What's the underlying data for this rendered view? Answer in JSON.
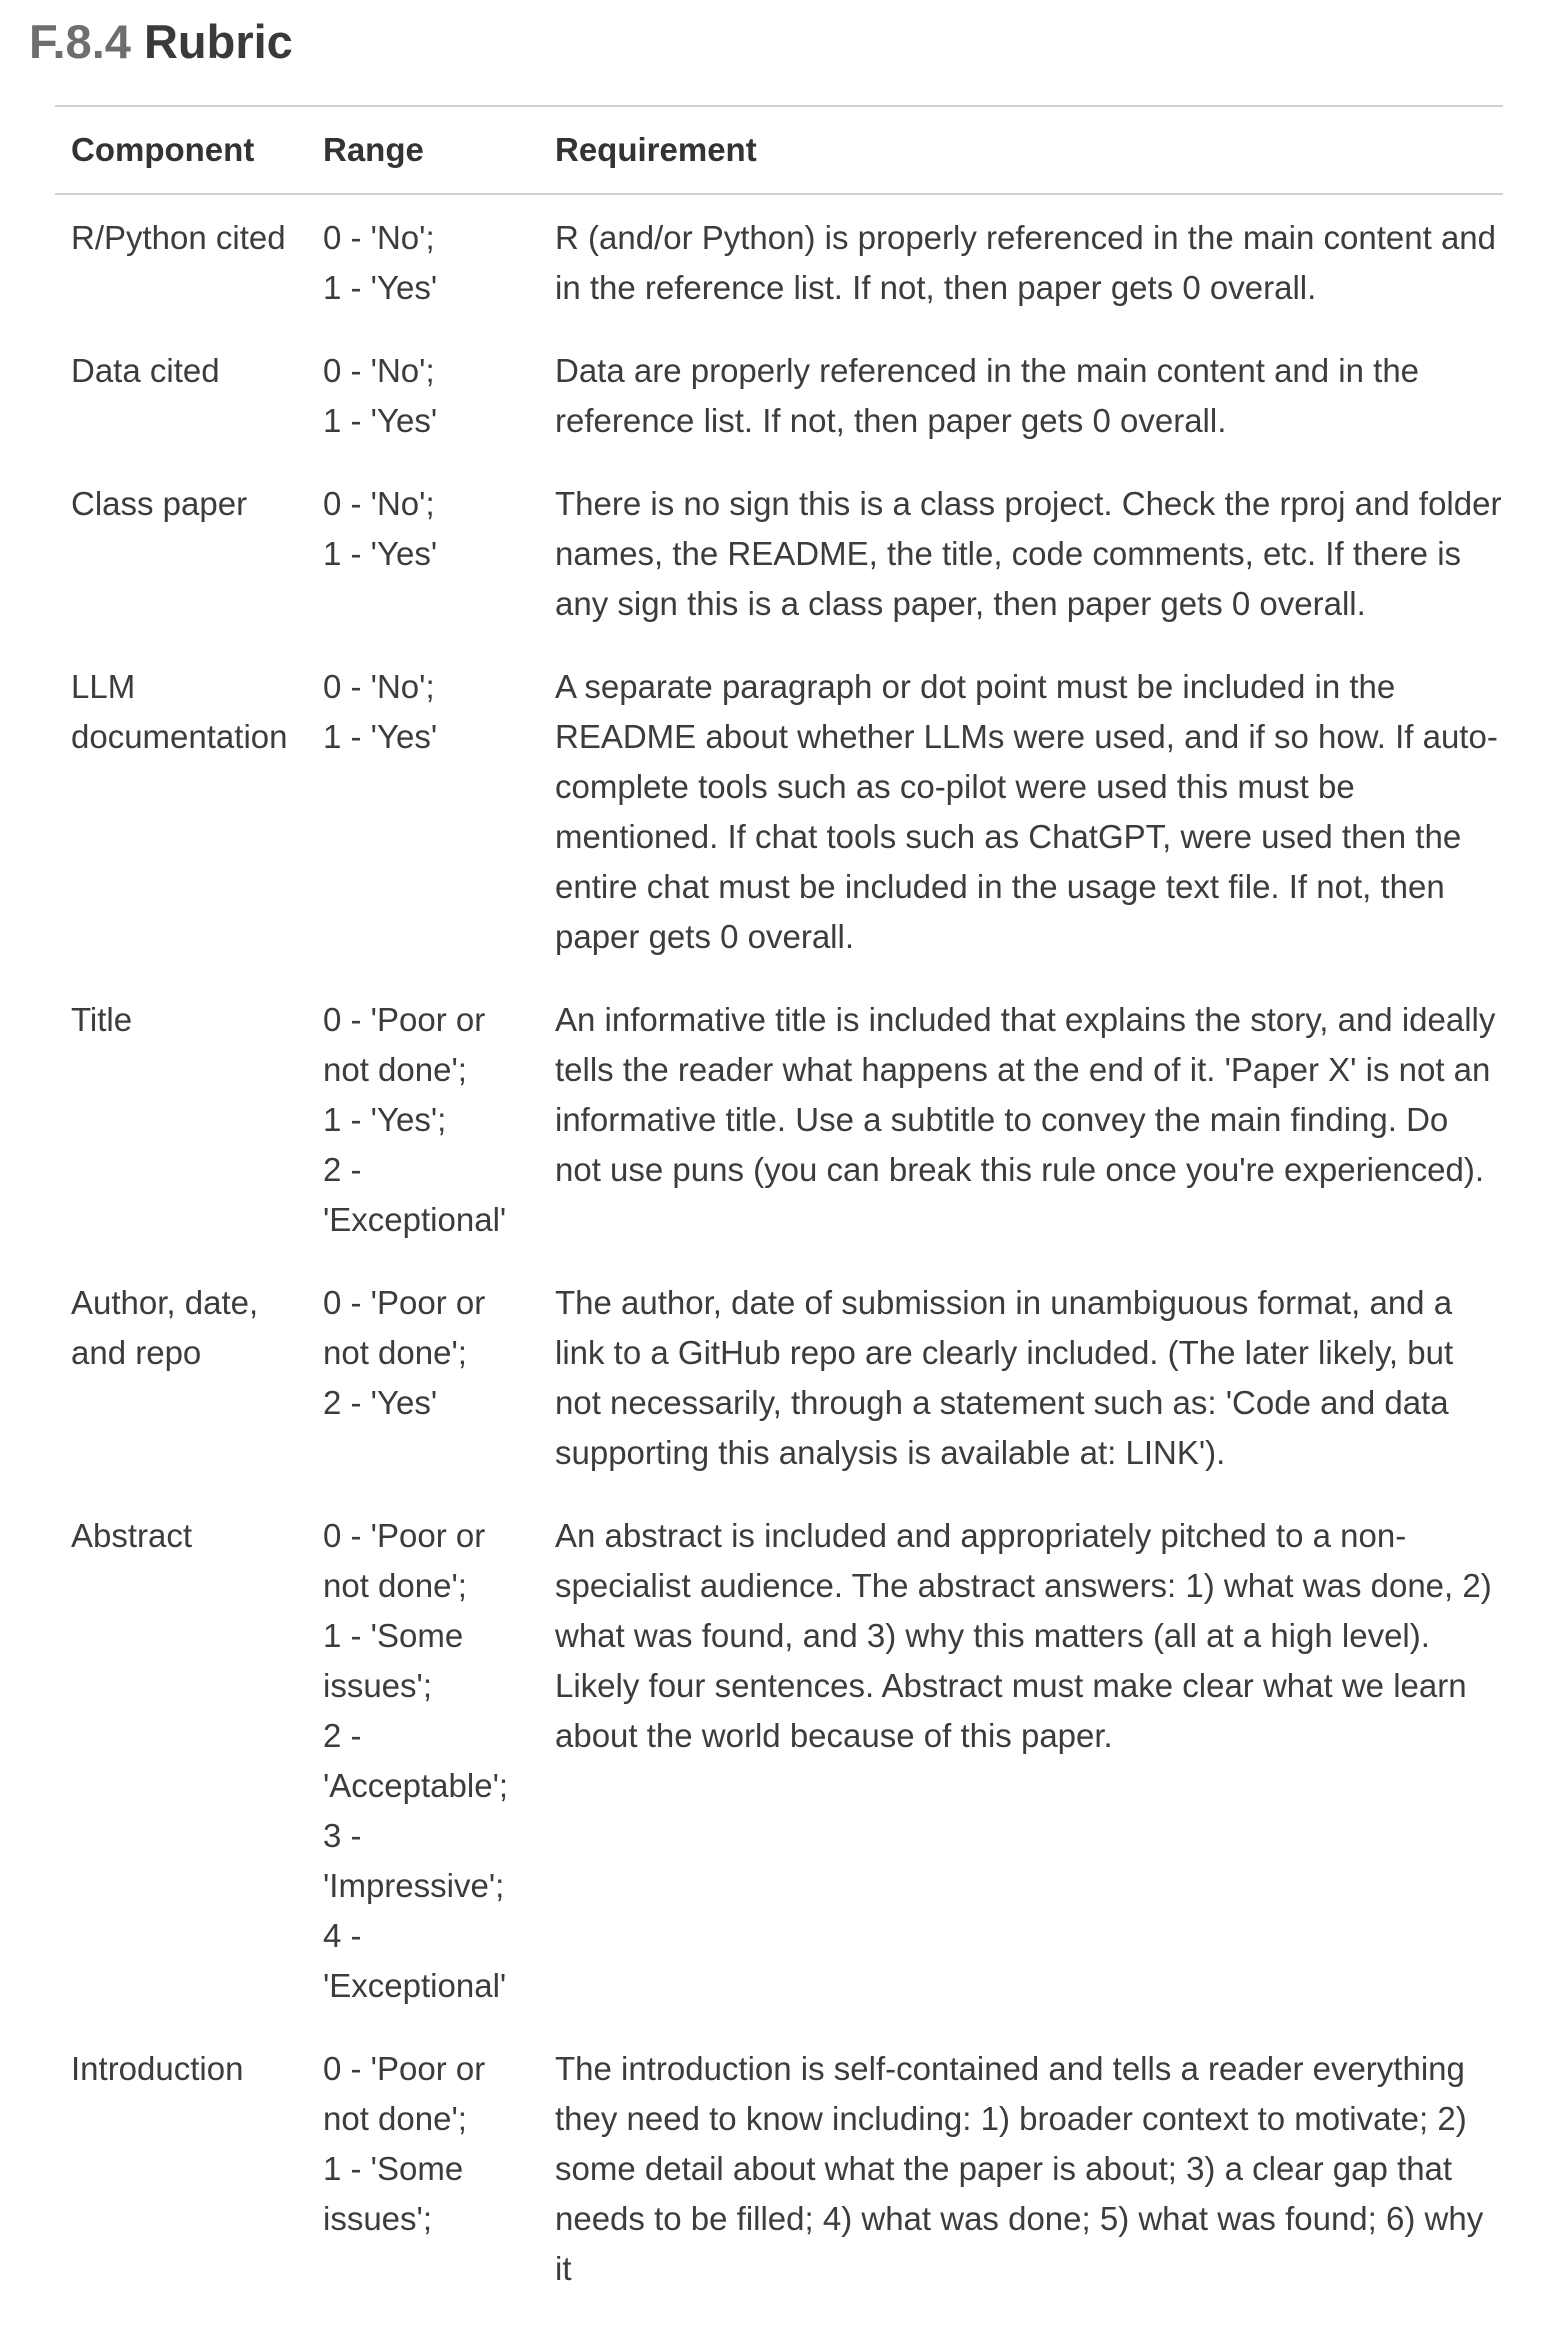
{
  "section": {
    "number": "F.8.4",
    "title": "Rubric"
  },
  "table": {
    "headers": {
      "component": "Component",
      "range": "Range",
      "requirement": "Requirement"
    },
    "rows": [
      {
        "component": "R/Python cited",
        "range": [
          "0 - 'No';",
          "1 - 'Yes'"
        ],
        "requirement": "R (and/or Python) is properly referenced in the main content and in the reference list. If not, then paper gets 0 overall."
      },
      {
        "component": "Data cited",
        "range": [
          "0 - 'No';",
          "1 - 'Yes'"
        ],
        "requirement": "Data are properly referenced in the main content and in the reference list. If not, then paper gets 0 overall."
      },
      {
        "component": "Class paper",
        "range": [
          "0 - 'No';",
          "1 - 'Yes'"
        ],
        "requirement": "There is no sign this is a class project. Check the rproj and folder names, the README, the title, code comments, etc. If there is any sign this is a class paper, then paper gets 0 overall."
      },
      {
        "component": "LLM documentation",
        "range": [
          "0 - 'No';",
          "1 - 'Yes'"
        ],
        "requirement": "A separate paragraph or dot point must be included in the README about whether LLMs were used, and if so how. If auto-complete tools such as co-pilot were used this must be mentioned. If chat tools such as ChatGPT, were used then the entire chat must be included in the usage text file. If not, then paper gets 0 overall."
      },
      {
        "component": "Title",
        "range": [
          "0 - 'Poor or not done';",
          "1 - 'Yes';",
          "2 - 'Exceptional'"
        ],
        "requirement": "An informative title is included that explains the story, and ideally tells the reader what happens at the end of it. 'Paper X' is not an informative title. Use a subtitle to convey the main finding. Do not use puns (you can break this rule once you're experienced)."
      },
      {
        "component": "Author, date, and repo",
        "range": [
          "0 - 'Poor or not done';",
          "2 - 'Yes'"
        ],
        "requirement": "The author, date of submission in unambiguous format, and a link to a GitHub repo are clearly included. (The later likely, but not necessarily, through a statement such as: 'Code and data supporting this analysis is available at: LINK')."
      },
      {
        "component": "Abstract",
        "range": [
          "0 - 'Poor or not done';",
          "1 - 'Some issues';",
          "2 - 'Acceptable';",
          "3 - 'Impressive';",
          "4 - 'Exceptional'"
        ],
        "requirement": "An abstract is included and appropriately pitched to a non-specialist audience. The abstract answers: 1) what was done, 2) what was found, and 3) why this matters (all at a high level). Likely four sentences. Abstract must make clear what we learn about the world because of this paper."
      },
      {
        "component": "Introduction",
        "range": [
          "0 - 'Poor or not done';",
          "1 - 'Some issues';"
        ],
        "requirement": "The introduction is self-contained and tells a reader everything they need to know including: 1) broader context to motivate; 2) some detail about what the paper is about; 3) a clear gap that needs to be filled; 4) what was done; 5) what was found; 6) why it"
      }
    ]
  }
}
